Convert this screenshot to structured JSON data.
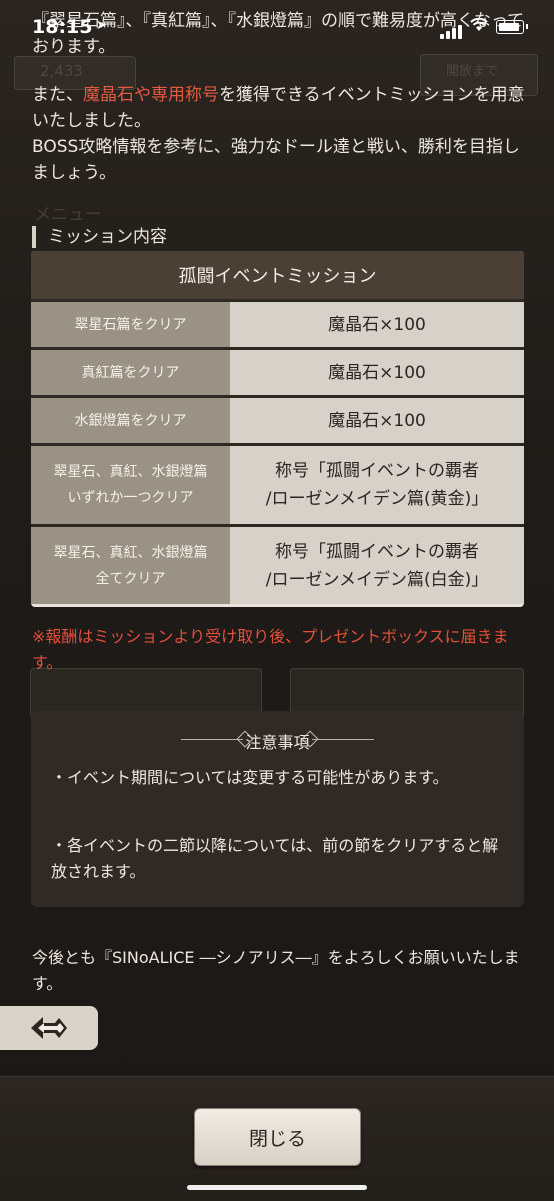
{
  "status_bar": {
    "time": "18:15",
    "location_arrow": "➤"
  },
  "intro": {
    "line_top": "『翠星石篇』、『真紅篇』、『水銀燈篇』の順で難易度が高くなっております。",
    "para2_pre": "また、",
    "para2_highlight": "魔晶石や専用称号",
    "para2_post": "を獲得できるイベントミッションを用意いたしました。",
    "para3": "BOSS攻略情報を参考に、強力なドール達と戦い、勝利を目指しましょう。"
  },
  "section_label": "ミッション内容",
  "mission_table": {
    "header": "孤闘イベントミッション",
    "rows": [
      {
        "condition": "翠星石篇をクリア",
        "reward": "魔晶石×100"
      },
      {
        "condition": "真紅篇をクリア",
        "reward": "魔晶石×100"
      },
      {
        "condition": "水銀燈篇をクリア",
        "reward": "魔晶石×100"
      },
      {
        "condition_line1": "翠星石、真紅、水銀燈篇",
        "condition_line2": "いずれか一つクリア",
        "reward_line1": "称号「孤闘イベントの覇者",
        "reward_line2": "/ローゼンメイデン篇(黄金)」"
      },
      {
        "condition_line1": "翠星石、真紅、水銀燈篇",
        "condition_line2": "全てクリア",
        "reward_line1": "称号「孤闘イベントの覇者",
        "reward_line2": "/ローゼンメイデン篇(白金)」"
      }
    ]
  },
  "reward_note": "※報酬はミッションより受け取り後、プレゼントボックスに届きます。",
  "caution": {
    "title": "注意事項",
    "items": [
      "・イベント期間については変更する可能性があります。",
      "・各イベントの二節以降については、前の節をクリアすると解放されます。"
    ]
  },
  "closing": "今後とも『SINoALICE ―シノアリス―』をよろしくお願いいたします。",
  "background": {
    "currency": "2,433",
    "menu": "メニュー",
    "until": "開放まで"
  },
  "buttons": {
    "close": "閉じる"
  },
  "icons": {
    "back": "back-arrow-icon",
    "wifi": "wifi-icon",
    "battery": "battery-icon",
    "signal": "signal-icon"
  }
}
